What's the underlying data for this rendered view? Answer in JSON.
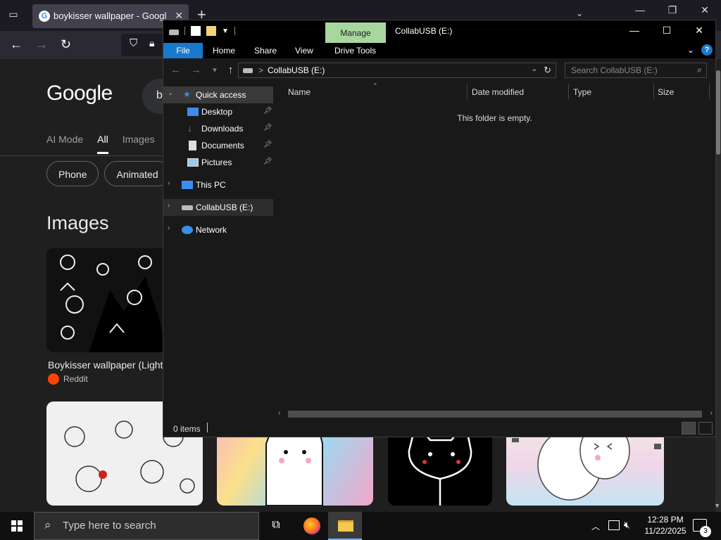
{
  "browser": {
    "tab": {
      "title": "boykisser wallpaper - Google Search",
      "favicon": "G",
      "close": "✕"
    },
    "new_tab": "+",
    "tab_list_chevron": "⌄",
    "window": {
      "minimize": "—",
      "maximize": "❐",
      "close": "✕"
    },
    "nav": {
      "back": "←",
      "forward": "→",
      "reload": "↻"
    }
  },
  "google": {
    "logo": "Google",
    "search_value": "b",
    "tabs": [
      "AI Mode",
      "All",
      "Images"
    ],
    "active_tab": "All",
    "chips": [
      "Phone",
      "Animated"
    ],
    "images_heading": "Images",
    "result1": {
      "caption": "Boykisser wallpaper (Light",
      "source": "Reddit"
    }
  },
  "explorer": {
    "contextual_tab": "Manage",
    "title": "CollabUSB (E:)",
    "window": {
      "minimize": "—",
      "maximize": "☐",
      "close": "✕"
    },
    "ribbon_tabs": [
      "File",
      "Home",
      "Share",
      "View",
      "Drive Tools"
    ],
    "help": "?",
    "address": {
      "path": "CollabUSB (E:)",
      "separator": ">"
    },
    "search_placeholder": "Search CollabUSB (E:)",
    "nav_pane": {
      "quick_access": "Quick access",
      "pinned": [
        "Desktop",
        "Downloads",
        "Documents",
        "Pictures"
      ],
      "this_pc": "This PC",
      "drive": "CollabUSB (E:)",
      "network": "Network"
    },
    "columns": [
      "Name",
      "Date modified",
      "Type",
      "Size"
    ],
    "empty_message": "This folder is empty.",
    "status": {
      "item_count": "0 items"
    }
  },
  "taskbar": {
    "search_placeholder": "Type here to search",
    "clock": {
      "time": "12:28 PM",
      "date": "11/22/2025"
    },
    "notification_count": "3"
  },
  "colors": {
    "manage_tab": "#a7d79e",
    "file_tab": "#1979ca",
    "quick_access_star": "#3b8eea"
  }
}
